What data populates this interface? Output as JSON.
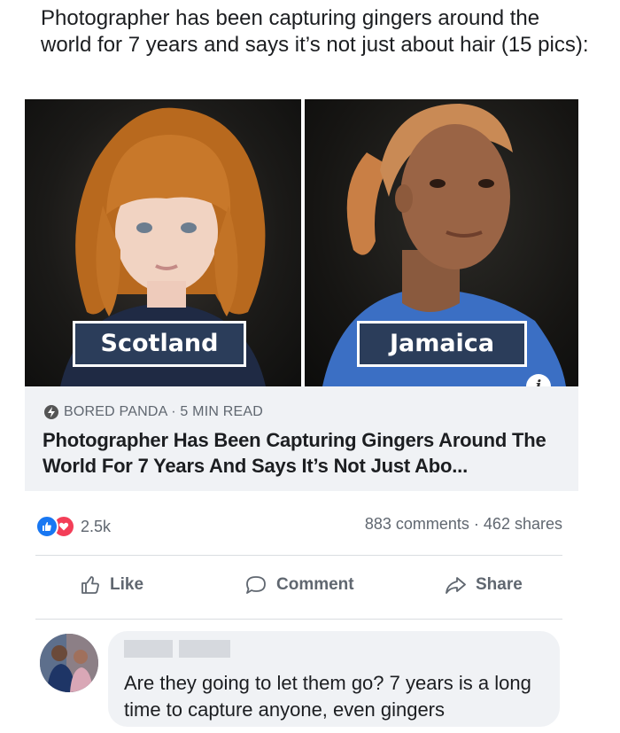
{
  "post": {
    "text": "Photographer has been capturing gingers around the world for 7 years and says it’s not just about hair (15 pics):"
  },
  "images": {
    "left_label": "Scotland",
    "right_label": "Jamaica",
    "info_icon": "i"
  },
  "link": {
    "source": "BORED PANDA · 5 MIN READ",
    "headline": "Photographer Has Been Capturing Gingers Around The World For 7 Years And Says It’s Not Just Abo..."
  },
  "stats": {
    "reaction_count": "2.5k",
    "counts": "883 comments · 462 shares"
  },
  "actions": {
    "like": "Like",
    "comment": "Comment",
    "share": "Share"
  },
  "comment": {
    "text": "Are they going to let them go? 7 years is a long time to capture anyone, even gingers"
  },
  "colors": {
    "accent": "#1877f2",
    "love": "#f33e58",
    "label_bg": "#2b3d5a",
    "muted": "#606770"
  }
}
